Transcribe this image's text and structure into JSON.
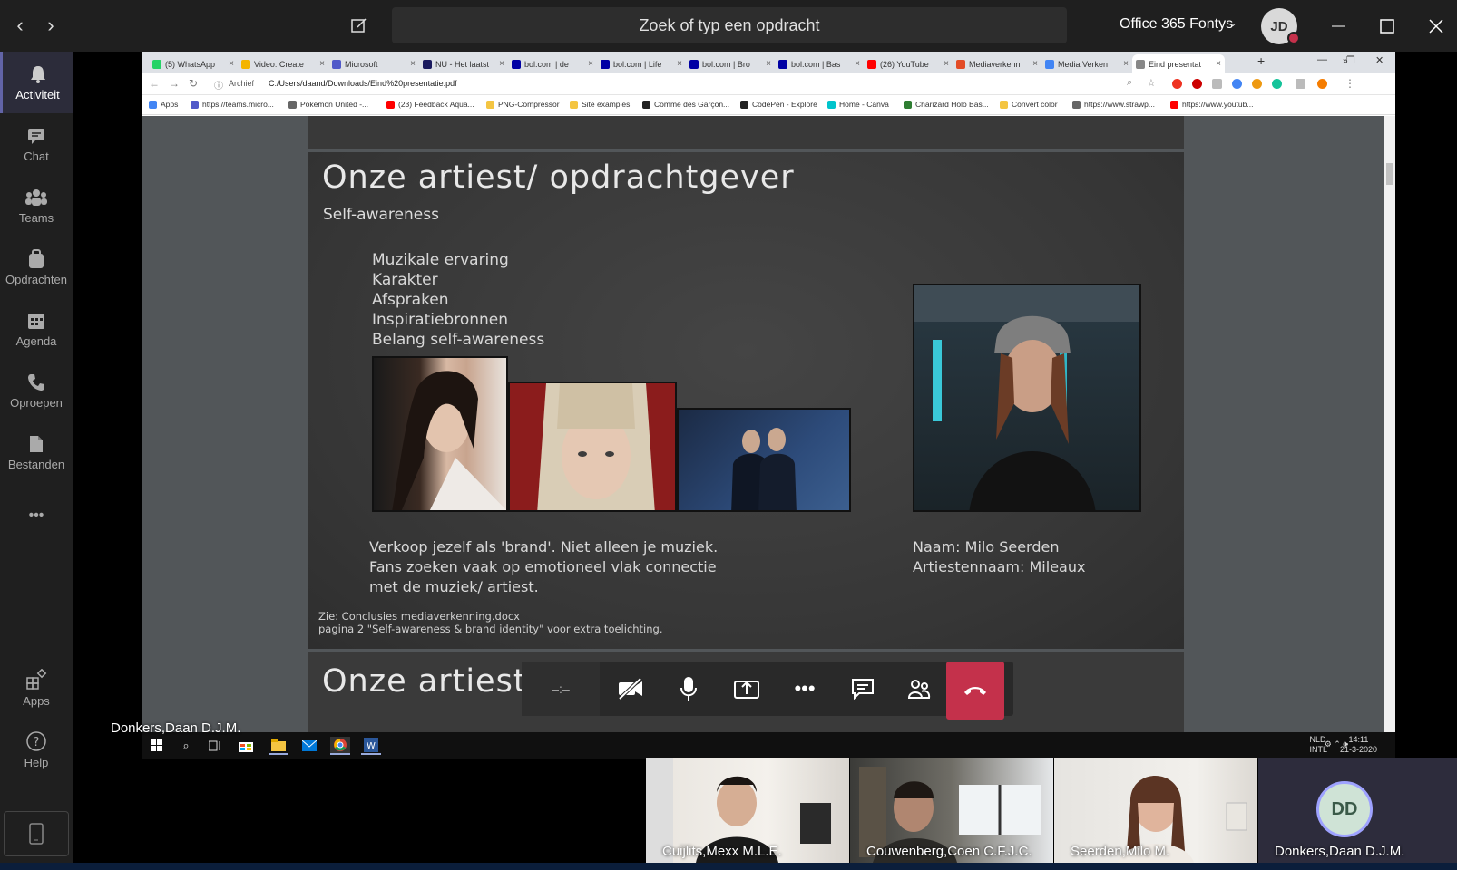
{
  "teams": {
    "search_placeholder": "Zoek of typ een opdracht",
    "org": "Office 365 Fontys",
    "avatar_initials": "JD",
    "rail": [
      {
        "label": "Activiteit",
        "icon": "bell-icon"
      },
      {
        "label": "Chat",
        "icon": "chat-icon"
      },
      {
        "label": "Teams",
        "icon": "teams-icon"
      },
      {
        "label": "Opdrachten",
        "icon": "assignments-icon"
      },
      {
        "label": "Agenda",
        "icon": "calendar-icon"
      },
      {
        "label": "Oproepen",
        "icon": "phone-icon"
      },
      {
        "label": "Bestanden",
        "icon": "files-icon"
      }
    ],
    "rail_more": "•••",
    "rail_apps": "Apps",
    "rail_help": "Help"
  },
  "browser": {
    "tabs": [
      {
        "label": "(5) WhatsApp",
        "color": "#25d366"
      },
      {
        "label": "Video: Create",
        "color": "#f4b400"
      },
      {
        "label": "Microsoft",
        "color": "#5059c9"
      },
      {
        "label": "NU - Het laatst",
        "color": "#1a1a5e"
      },
      {
        "label": "bol.com | de",
        "color": "#0000a4"
      },
      {
        "label": "bol.com | Life",
        "color": "#0000a4"
      },
      {
        "label": "bol.com | Bro",
        "color": "#0000a4"
      },
      {
        "label": "bol.com | Bas",
        "color": "#0000a4"
      },
      {
        "label": "(26) YouTube",
        "color": "#ff0000"
      },
      {
        "label": "Mediaverkenn",
        "color": "#e34c26"
      },
      {
        "label": "Media Verken",
        "color": "#4285f4"
      },
      {
        "label": "Eind presentat",
        "color": "#888888"
      }
    ],
    "address_info": "Archief",
    "address_url": "C:/Users/daand/Downloads/Eind%20presentatie.pdf",
    "bookmarks": [
      {
        "label": "Apps",
        "color": "#4285f4"
      },
      {
        "label": "https://teams.micro...",
        "color": "#5059c9"
      },
      {
        "label": "Pokémon United -...",
        "color": "#666666"
      },
      {
        "label": "(23) Feedback Aqua...",
        "color": "#ff0000"
      },
      {
        "label": "PNG-Compressor",
        "color": "#f4c542"
      },
      {
        "label": "Site examples",
        "color": "#f4c542"
      },
      {
        "label": "Comme des Garçon...",
        "color": "#222222"
      },
      {
        "label": "CodePen - Explore",
        "color": "#222222"
      },
      {
        "label": "Home - Canva",
        "color": "#00c4cc"
      },
      {
        "label": "Charizard Holo Bas...",
        "color": "#2e7d32"
      },
      {
        "label": "Convert color",
        "color": "#f4c542"
      },
      {
        "label": "https://www.strawp...",
        "color": "#666666"
      },
      {
        "label": "https://www.youtub...",
        "color": "#ff0000"
      }
    ]
  },
  "slide": {
    "title": "Onze artiest/ opdrachtgever",
    "subtitle": "Self-awareness",
    "list": [
      "Muzikale ervaring",
      "Karakter",
      "Afspraken",
      "Inspiratiebronnen",
      "Belang self-awareness"
    ],
    "body": [
      "Verkoop jezelf als 'brand'. Niet alleen je muziek.",
      "Fans zoeken vaak op emotioneel vlak connectie",
      "met de muziek/ artiest."
    ],
    "name_line1": "Naam: Milo Seerden",
    "name_line2": "Artiestennaam: Mileaux",
    "note_line1": "Zie: Conclusies mediaverkenning.docx",
    "note_line2": "pagina 2 \"Self-awareness & brand identity\" voor extra toelichting.",
    "next_title": "Onze artiest/ opdrachtgever"
  },
  "call": {
    "timer": "–:–",
    "presenter": "Donkers,Daan D.J.M."
  },
  "taskbar": {
    "lang": "NLD",
    "layout": "INTL",
    "time": "14:11",
    "date": "21-3-2020"
  },
  "participants": [
    {
      "name": "Cuijlits,Mexx M.L.E."
    },
    {
      "name": "Couwenberg,Coen C.F.J.C."
    },
    {
      "name": "Seerden,Milo M."
    },
    {
      "name": "Donkers,Daan D.J.M.",
      "initials": "DD"
    }
  ]
}
